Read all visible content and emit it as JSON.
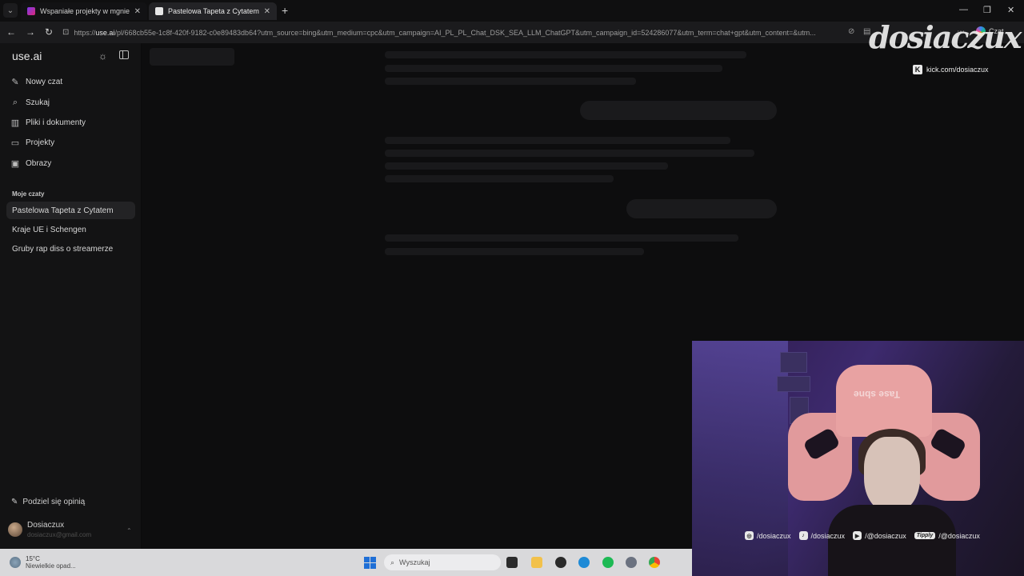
{
  "browser": {
    "tabs": [
      {
        "title": "Wspaniałe projekty w mgnieniu oka",
        "active": false
      },
      {
        "title": "Pastelowa Tapeta z Cytatem | Use",
        "active": true
      }
    ],
    "address": {
      "prefix": "https://",
      "domain": "use.ai",
      "path": "/pl/668cb55e-1c8f-420f-9182-c0e89483db64?utm_source=bing&utm_medium=cpc&utm_campaign=AI_PL_PL_Chat_DSK_SEA_LLM_ChatGPT&utm_campaign_id=524286077&utm_term=chat+gpt&utm_content=&utm..."
    },
    "czat_label": "Czat"
  },
  "sidebar": {
    "brand": "use.ai",
    "nav": [
      {
        "label": "Nowy czat",
        "icon": "edit-icon"
      },
      {
        "label": "Szukaj",
        "icon": "search-icon"
      },
      {
        "label": "Pliki i dokumenty",
        "icon": "library-icon"
      },
      {
        "label": "Projekty",
        "icon": "folder-icon"
      },
      {
        "label": "Obrazy",
        "icon": "image-icon"
      }
    ],
    "section_label": "Moje czaty",
    "chats": [
      {
        "label": "Pastelowa Tapeta z Cytatem",
        "active": true
      },
      {
        "label": "Kraje UE i Schengen",
        "active": false
      },
      {
        "label": "Gruby rap diss o streamerze",
        "active": false
      }
    ],
    "feedback_label": "Podziel się opinią",
    "user": {
      "name": "Dosiaczux",
      "email": "dosiaczux@gmail.com"
    }
  },
  "overlay": {
    "logo": "dosiaczux",
    "kick": "kick.com/dosiaczux",
    "socials": [
      {
        "icon": "instagram-icon",
        "handle": "/dosiaczux"
      },
      {
        "icon": "tiktok-icon",
        "handle": "/dosiaczux"
      },
      {
        "icon": "youtube-icon",
        "handle": "/@dosiaczux"
      },
      {
        "icon": "tipply-icon",
        "badge": "Tipply",
        "handle": "/@dosiaczux"
      }
    ],
    "chair_brand": "Tase sbne"
  },
  "taskbar": {
    "weather_temp": "15°C",
    "weather_desc": "Niewielkie opad...",
    "search_placeholder": "Wyszukaj"
  }
}
